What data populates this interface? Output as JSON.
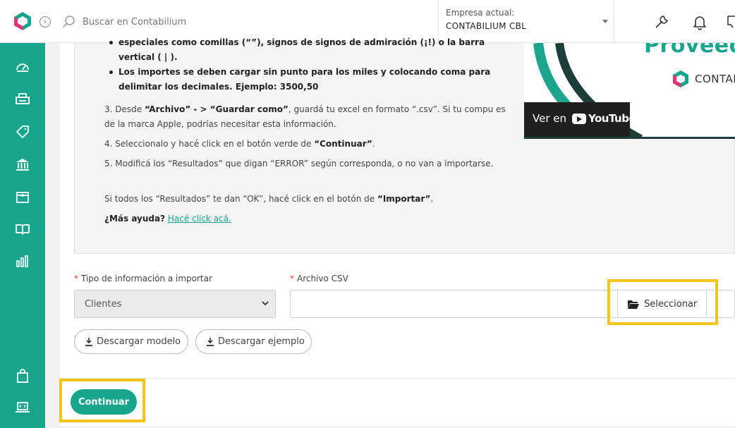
{
  "header": {
    "search_placeholder": "Buscar en Contabilium",
    "company_label": "Empresa actual:",
    "company_value": "CONTABILIUM CBL",
    "collapse_glyph": "›"
  },
  "sidebar": {
    "items": [
      "dashboard-icon",
      "printer-icon",
      "tag-icon",
      "bank-icon",
      "box-icon",
      "book-icon",
      "chart-icon",
      "shopping-bag-icon",
      "laptop-code-icon"
    ]
  },
  "instructions": {
    "bullet_partial": "especiales como comillas (“”), signos de signos de admiración (¡!) o la barra vertical ( | ).",
    "bullet_amounts": "Los importes se deben cargar sin punto para los miles y colocando coma para delimitar los decimales. Ejemplo: 3500,50",
    "step3_pre": "3. Desde ",
    "step3_b1": "“Archivo” - > “Guardar como”",
    "step3_post": ", guardá tu excel en formato “.csv”. Si tu compu es de la marca Apple, podrías necesitar esta información.",
    "step4_pre": "4. Seleccionalo y hacé click en el botón verde de ",
    "step4_b": "“Continuar”",
    "step4_post": ".",
    "step5": "5. Modificá los “Resultados” que digan “ERROR” según corresponda, o no van a importarse.",
    "final_pre": "Si todos los “Resultados” te dan “OK”, hacé click en el botón de ",
    "final_b": "“Importar”",
    "final_post": ".",
    "help_q": "¿Más ayuda?",
    "help_link": "Hacé click acá."
  },
  "video": {
    "title": "Proveedo",
    "brand": "CONTABILI",
    "watch_label": "Ver en",
    "platform": "YouTube"
  },
  "form": {
    "type_label": "Tipo de información a importar",
    "type_value": "Clientes",
    "csv_label": "Archivo CSV",
    "select_button": "Seleccionar",
    "download_model": "Descargar modelo",
    "download_example": "Descargar ejemplo",
    "continue_button": "Continuar"
  },
  "colors": {
    "brand": "#17a58c",
    "highlight": "#f5c518"
  }
}
